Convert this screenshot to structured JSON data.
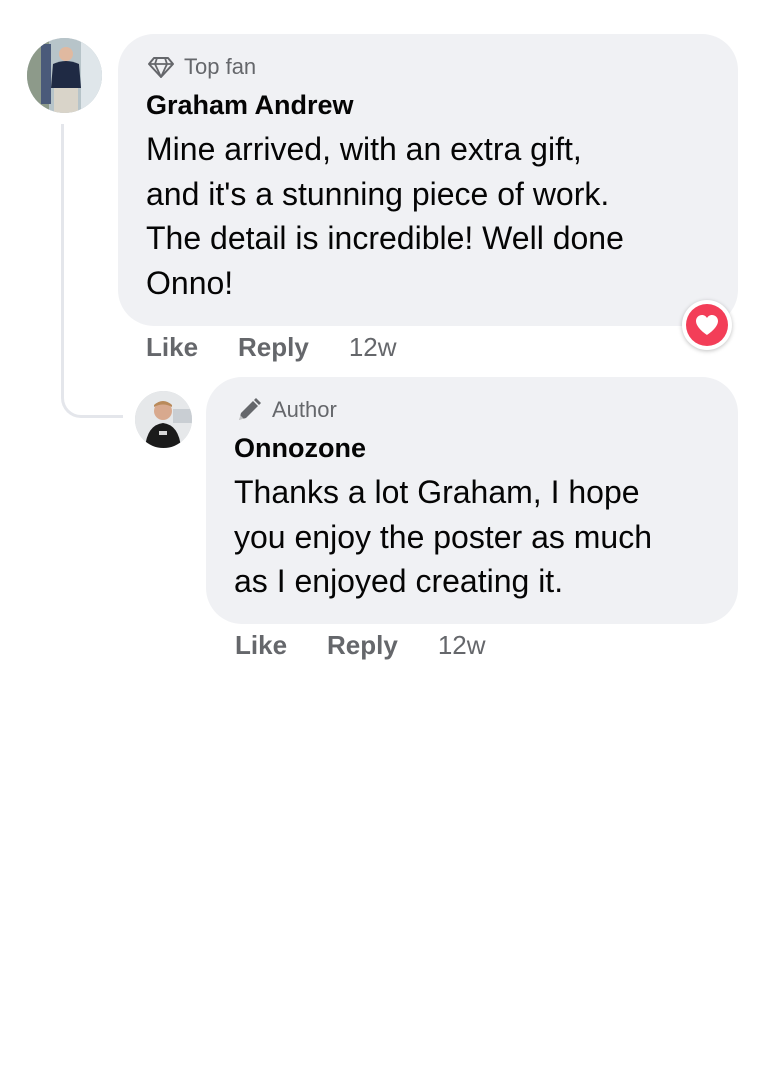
{
  "comments": [
    {
      "badge": "Top fan",
      "badge_icon": "diamond-icon",
      "author": "Graham Andrew",
      "text": "Mine arrived, with an extra gift,\nand it's a stunning piece of work.\nThe detail is incredible! Well done\nOnno!",
      "like_label": "Like",
      "reply_label": "Reply",
      "time": "12w",
      "reaction": "heart-reaction-icon"
    }
  ],
  "reply": {
    "badge": "Author",
    "badge_icon": "pen-icon",
    "author": "Onnozone",
    "text": "Thanks a lot Graham, I hope\nyou enjoy the poster as much\nas I enjoyed creating it.",
    "like_label": "Like",
    "reply_label": "Reply",
    "time": "12w"
  },
  "colors": {
    "bubble": "#f0f1f4",
    "secondary_text": "#65676b",
    "primary_text": "#050505",
    "heart": "#f33e58",
    "thread_line": "#e4e6eb"
  }
}
